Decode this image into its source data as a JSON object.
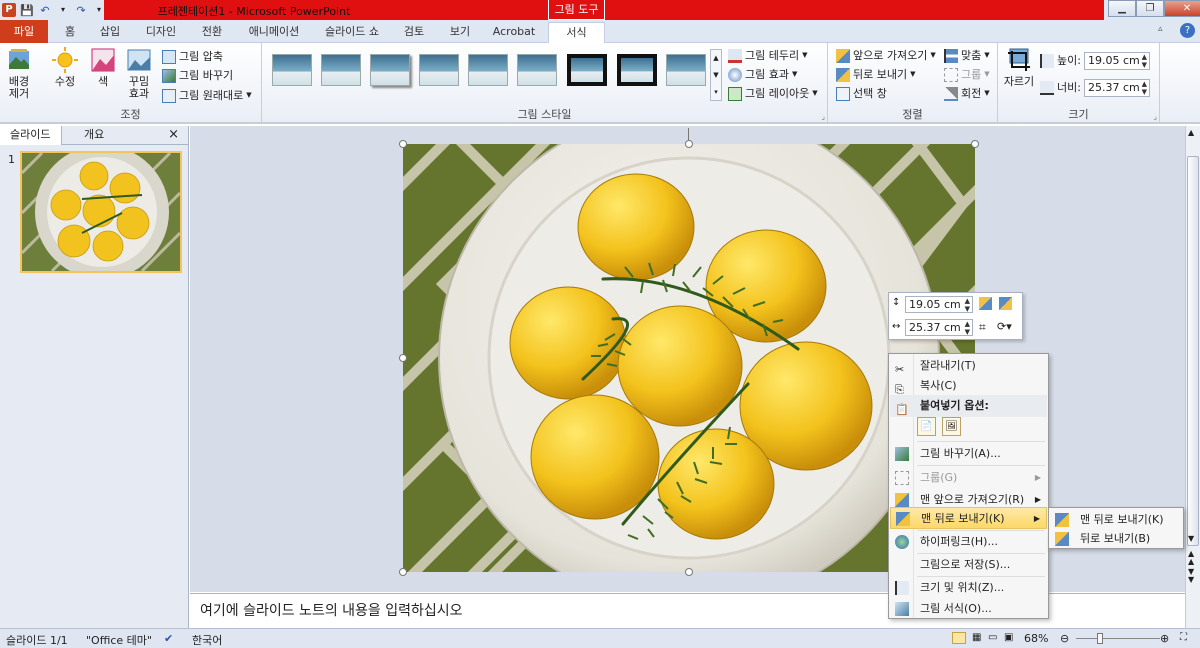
{
  "window": {
    "doc_title": "프레젠테이션1 - Microsoft PowerPoint",
    "context_tab": "그림 도구",
    "help": "?"
  },
  "qat": {
    "app": "P",
    "save": "💾",
    "undo": "↶",
    "redo": "↷",
    "more": "▾"
  },
  "tabs": [
    {
      "label": "파일"
    },
    {
      "label": "홈"
    },
    {
      "label": "삽입"
    },
    {
      "label": "디자인"
    },
    {
      "label": "전환"
    },
    {
      "label": "애니메이션"
    },
    {
      "label": "슬라이드 쇼"
    },
    {
      "label": "검토"
    },
    {
      "label": "보기"
    },
    {
      "label": "Acrobat"
    },
    {
      "label": "서식"
    }
  ],
  "ribbon": {
    "adjust": {
      "label": "조정",
      "remove_bg": "배경\n제거",
      "corrections": "수정",
      "color": "색",
      "artistic": "꾸밈\n효과",
      "compress": "그림 압축",
      "change": "그림 바꾸기",
      "reset": "그림 원래대로"
    },
    "styles": {
      "label": "그림 스타일",
      "border": "그림 테두리",
      "effects": "그림 효과",
      "layout": "그림 레이아웃"
    },
    "arrange": {
      "label": "정렬",
      "bring_forward": "앞으로 가져오기",
      "send_backward": "뒤로 보내기",
      "selection_pane": "선택 창",
      "align": "맞춤",
      "group": "그룹",
      "rotate": "회전"
    },
    "size": {
      "label": "크기",
      "crop": "자르기",
      "height_label": "높이:",
      "height_value": "19.05 cm",
      "width_label": "너비:",
      "width_value": "25.37 cm"
    }
  },
  "left_pane": {
    "tab_slides": "슬라이드",
    "tab_outline": "개요",
    "close": "×",
    "slide_number": "1"
  },
  "notes": {
    "placeholder": "여기에 슬라이드 노트의 내용을 입력하십시오"
  },
  "mini_toolbar": {
    "height": "19.05 cm",
    "width": "25.37 cm"
  },
  "context_menu": {
    "cut": "잘라내기(T)",
    "copy": "복사(C)",
    "paste_options": "붙여넣기 옵션:",
    "change_picture": "그림 바꾸기(A)...",
    "group": "그룹(G)",
    "bring_front": "맨 앞으로 가져오기(R)",
    "send_back": "맨 뒤로 보내기(K)",
    "hyperlink": "하이퍼링크(H)...",
    "save_as_picture": "그림으로 저장(S)...",
    "size_position": "크기 및 위치(Z)...",
    "format_picture": "그림 서식(O)..."
  },
  "submenu": {
    "send_to_back": "맨 뒤로 보내기(K)",
    "send_backward": "뒤로 보내기(B)"
  },
  "status": {
    "slide": "슬라이드 1/1",
    "theme": "\"Office 테마\"",
    "language": "한국어",
    "zoom": "68%"
  },
  "colors": {
    "file_tab": "#d03d1a",
    "title_red": "#e01010",
    "highlight": "#fcd867",
    "plate": "#ecebe6"
  },
  "icons": [
    "save-icon",
    "undo-icon",
    "redo-icon",
    "scissors-icon",
    "copy-icon",
    "paste-icon",
    "hyperlink-icon",
    "bring-front-icon",
    "send-back-icon",
    "crop-icon",
    "rotate-icon"
  ]
}
